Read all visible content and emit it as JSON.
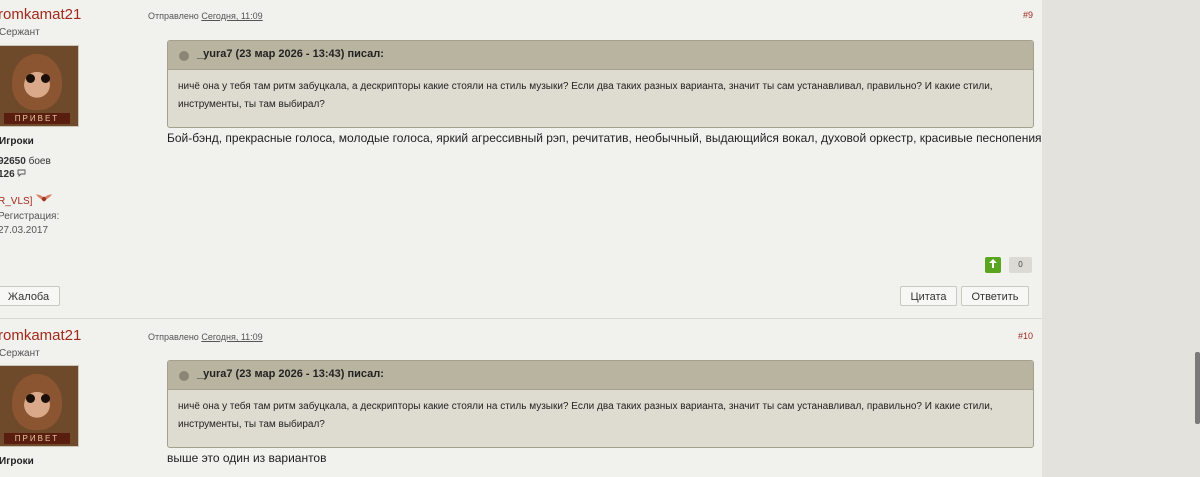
{
  "posts": [
    {
      "username": "romkamat21",
      "rank": "Сержант",
      "avatar_caption": "ПРИВЕТ",
      "group": "Игроки",
      "battles_value": "92650",
      "battles_label": "боев",
      "comments_value": "126",
      "clan": "R_VLS]",
      "reg_label": "Регистрация:",
      "reg_date": "27.03.2017",
      "sent_label": "Отправлено",
      "sent_time": "Сегодня, 11:09",
      "post_number": "#9",
      "quote_title": "_yura7 (23 мар 2026 - 13:43) писал:",
      "quote_text": "ничё она у тебя там ритм забуцкала, а дескрипторы какие стояли на стиль музыки? Если два таких разных варианта, значит ты сам устанавливал, правильно? И какие стили, инструменты, ты там выбирал?",
      "body": "Бой-бэнд, прекрасные голоса, молодые голоса, яркий агрессивный рэп, речитатив, необычный, выдающийся вокал, духовой оркестр, красивые песнопения, музыкальные перех",
      "vote_count": "0",
      "complaint_label": "Жалоба",
      "quote_btn_label": "Цитата",
      "reply_btn_label": "Ответить"
    },
    {
      "username": "romkamat21",
      "rank": "Сержант",
      "avatar_caption": "ПРИВЕТ",
      "group": "Игроки",
      "sent_label": "Отправлено",
      "sent_time": "Сегодня, 11:09",
      "post_number": "#10",
      "quote_title": "_yura7 (23 мар 2026 - 13:43) писал:",
      "quote_text": "ничё она у тебя там ритм забуцкала, а дескрипторы какие стояли на стиль музыки? Если два таких разных варианта, значит ты сам устанавливал, правильно? И какие стили, инструменты, ты там выбирал?",
      "body": "выше это один из вариантов"
    }
  ],
  "icons": {
    "comment": "speech-bubble-icon",
    "clan_badge": "wings-badge-icon",
    "upvote": "arrow-up-icon",
    "quote": "quote-icon"
  },
  "colors": {
    "username": "#a22a1c",
    "upvote": "#5aa51f",
    "quote_header": "#b9b4a0",
    "quote_body": "#dedbd0"
  }
}
